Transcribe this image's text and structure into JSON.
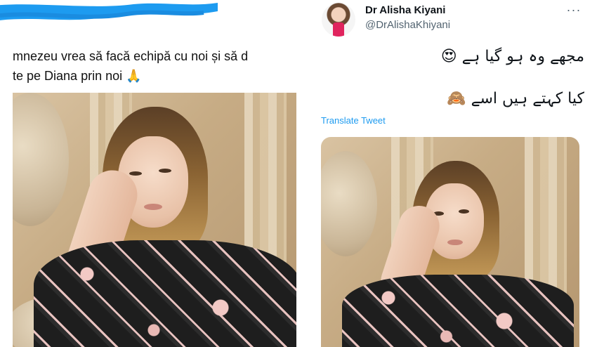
{
  "left_post": {
    "text": "mnezeu vrea să facă echipă cu noi și să d\nte pe Diana prin noi 🙏",
    "image_alt": "photo"
  },
  "tweet": {
    "display_name": "Dr Alisha Kiyani",
    "handle": "@DrAlishaKhiyani",
    "more_icon": "···",
    "line1": "مجھے وہ ہو گیا ہے 😍",
    "line2": "کیا کہتے ہیں اسے 🙈",
    "translate_label": "Translate Tweet"
  },
  "colors": {
    "redaction": "#1d9bf0",
    "link": "#1d9bf0",
    "text": "#0f1419",
    "muted": "#536471"
  }
}
